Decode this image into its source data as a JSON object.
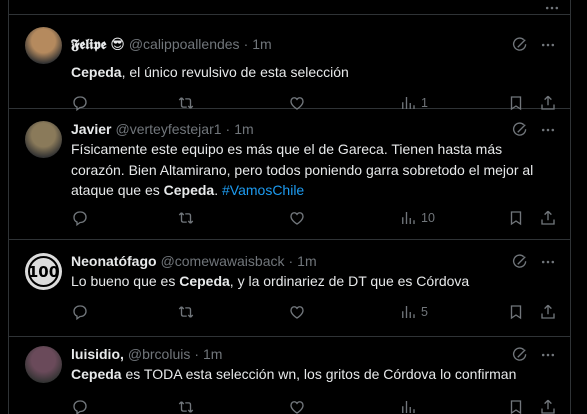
{
  "tweets": [
    {
      "name": "𝕱𝖊𝖑𝖎𝖕𝖊 😎",
      "handle": "@calippoallendes",
      "sep": "·",
      "time": "1m",
      "text_parts": [
        {
          "t": "Cepeda",
          "s": "bold"
        },
        {
          "t": ", el único revulsivo de esta selección",
          "s": "plain"
        }
      ],
      "views": "1",
      "avatar_color": "#b58a5e"
    },
    {
      "name": "Javier",
      "handle": "@verteyfestejar1",
      "sep": "·",
      "time": "1m",
      "text_parts": [
        {
          "t": "Físicamente este equipo es más que el de Gareca. Tienen hasta más corazón. Bien Altamirano, pero todos poniendo garra sobretodo el mejor al ataque que es ",
          "s": "plain"
        },
        {
          "t": "Cepeda",
          "s": "bold"
        },
        {
          "t": ". ",
          "s": "plain"
        },
        {
          "t": "#VamosChile",
          "s": "hashtag"
        }
      ],
      "views": "10",
      "avatar_color": "#8a7a5a"
    },
    {
      "name": "Neonatófago",
      "handle": "@comewawaisback",
      "sep": "·",
      "time": "1m",
      "text_parts": [
        {
          "t": "Lo bueno que es ",
          "s": "plain"
        },
        {
          "t": "Cepeda",
          "s": "bold"
        },
        {
          "t": ", y la ordinariez de DT que es Córdova",
          "s": "plain"
        }
      ],
      "views": "5",
      "avatar_color": "#dcdcdc",
      "avatar_text": "100"
    },
    {
      "name": "luisidio,",
      "handle": "@brcoluis",
      "sep": "·",
      "time": "1m",
      "text_parts": [
        {
          "t": "Cepeda",
          "s": "bold"
        },
        {
          "t": " es TODA esta selección wn, los gritos de Córdova lo confirman",
          "s": "plain"
        }
      ],
      "views": "",
      "avatar_color": "#6a4a5a"
    }
  ],
  "icons": {
    "reply": "reply-icon",
    "retweet": "retweet-icon",
    "like": "like-icon",
    "views": "views-icon",
    "bookmark": "bookmark-icon",
    "share": "share-icon",
    "grok": "grok-icon",
    "more": "more-icon"
  },
  "colors": {
    "background": "#000000",
    "text": "#e7e9ea",
    "secondary": "#71767b",
    "link": "#1d9bf0",
    "border": "#2f3336"
  }
}
